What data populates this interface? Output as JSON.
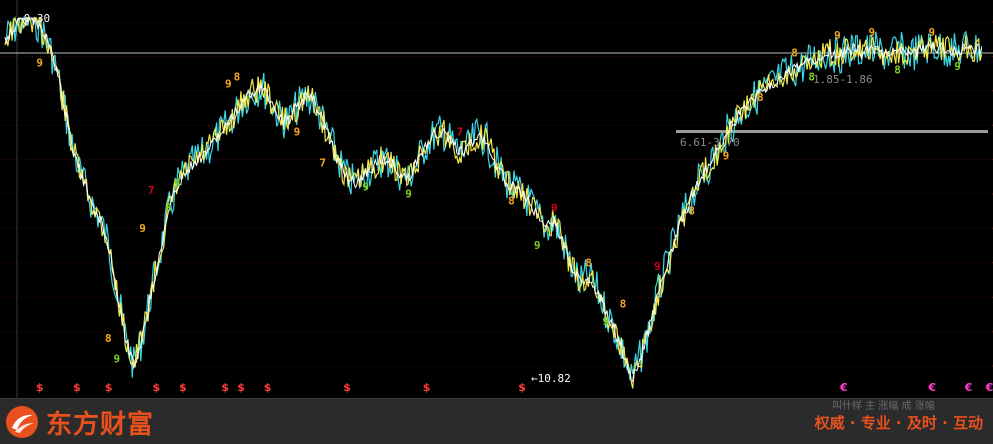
{
  "chart_data": {
    "type": "line",
    "title": "",
    "annotations": {
      "high_marker": "←0.30",
      "low_marker": "←10.82",
      "range_upper": "1.85-1.86",
      "range_lower": "6.61-3.70"
    },
    "series": [
      {
        "values": [
          0.9,
          0.6,
          0.4,
          0.3,
          0.5,
          1.0,
          1.8,
          3.0,
          4.2,
          5.0,
          5.6,
          6.1,
          6.8,
          8.2,
          9.5,
          10.4,
          9.6,
          8.3,
          7.2,
          6.0,
          5.2,
          4.8,
          4.5,
          4.3,
          4.0,
          3.7,
          3.4,
          3.0,
          2.6,
          2.4,
          2.3,
          2.7,
          3.2,
          3.3,
          2.9,
          2.6,
          2.7,
          3.3,
          3.9,
          4.5,
          5.0,
          5.1,
          4.8,
          4.6,
          4.4,
          4.5,
          4.8,
          5.0,
          4.5,
          4.0,
          3.7,
          3.6,
          3.9,
          4.2,
          4.1,
          3.7,
          3.8,
          4.4,
          4.9,
          5.2,
          5.4,
          5.6,
          6.0,
          6.4,
          6.2,
          6.8,
          7.5,
          8.0,
          7.8,
          8.2,
          8.8,
          9.3,
          10.0,
          10.8,
          10.2,
          9.4,
          8.4,
          7.6,
          6.8,
          6.1,
          5.5,
          5.0,
          4.6,
          4.2,
          3.7,
          3.3,
          3.0,
          2.7,
          2.5,
          2.3,
          2.1,
          1.9,
          1.8,
          1.7,
          1.5,
          1.4,
          1.3,
          1.4,
          1.3,
          1.2,
          1.3,
          1.2,
          1.3,
          1.4,
          1.2,
          1.3,
          1.3,
          1.2,
          1.1,
          1.2,
          1.2,
          1.3,
          1.1,
          1.2,
          1.2
        ]
      }
    ],
    "signals": [
      {
        "label": "9",
        "i": 4,
        "v": 1.6,
        "color": "#f5a623"
      },
      {
        "label": "8",
        "i": 12,
        "v": 9.6,
        "color": "#f5a623"
      },
      {
        "label": "9",
        "i": 13,
        "v": 10.2,
        "color": "#7ed321"
      },
      {
        "label": "9",
        "i": 16,
        "v": 6.4,
        "color": "#f5a623"
      },
      {
        "label": "7",
        "i": 17,
        "v": 5.3,
        "color": "#d0021b"
      },
      {
        "label": "8",
        "i": 19,
        "v": 5.8,
        "color": "#7ed321"
      },
      {
        "label": "9",
        "i": 20,
        "v": 5.1,
        "color": "#7ed321"
      },
      {
        "label": "9",
        "i": 26,
        "v": 2.2,
        "color": "#f5a623"
      },
      {
        "label": "8",
        "i": 27,
        "v": 2.0,
        "color": "#f5a623"
      },
      {
        "label": "9",
        "i": 34,
        "v": 3.6,
        "color": "#f5a623"
      },
      {
        "label": "7",
        "i": 37,
        "v": 4.5,
        "color": "#f5a623"
      },
      {
        "label": "9",
        "i": 42,
        "v": 5.2,
        "color": "#7ed321"
      },
      {
        "label": "9",
        "i": 47,
        "v": 5.4,
        "color": "#7ed321"
      },
      {
        "label": "7",
        "i": 53,
        "v": 3.6,
        "color": "#d0021b"
      },
      {
        "label": "8",
        "i": 59,
        "v": 5.6,
        "color": "#f5a623"
      },
      {
        "label": "9",
        "i": 62,
        "v": 6.9,
        "color": "#7ed321"
      },
      {
        "label": "9",
        "i": 64,
        "v": 5.8,
        "color": "#d0021b"
      },
      {
        "label": "8",
        "i": 68,
        "v": 7.4,
        "color": "#f5a623"
      },
      {
        "label": "9",
        "i": 70,
        "v": 9.1,
        "color": "#7ed321"
      },
      {
        "label": "8",
        "i": 72,
        "v": 8.6,
        "color": "#f5a623"
      },
      {
        "label": "9",
        "i": 76,
        "v": 7.5,
        "color": "#d0021b"
      },
      {
        "label": "8",
        "i": 80,
        "v": 5.9,
        "color": "#f5a623"
      },
      {
        "label": "9",
        "i": 84,
        "v": 4.3,
        "color": "#f5a623"
      },
      {
        "label": "8",
        "i": 88,
        "v": 2.6,
        "color": "#f5a623"
      },
      {
        "label": "8",
        "i": 92,
        "v": 1.3,
        "color": "#f5a623"
      },
      {
        "label": "8",
        "i": 94,
        "v": 2.0,
        "color": "#7ed321"
      },
      {
        "label": "9",
        "i": 97,
        "v": 0.8,
        "color": "#f5a623"
      },
      {
        "label": "9",
        "i": 101,
        "v": 0.7,
        "color": "#f5a623"
      },
      {
        "label": "8",
        "i": 104,
        "v": 1.8,
        "color": "#7ed321"
      },
      {
        "label": "9",
        "i": 108,
        "v": 0.7,
        "color": "#f5a623"
      },
      {
        "label": "9",
        "i": 111,
        "v": 1.7,
        "color": "#7ed321"
      }
    ],
    "buy_markers": [
      3,
      10,
      16,
      25,
      30,
      38,
      41,
      46,
      61,
      76,
      94
    ],
    "sell_markers": [
      150,
      167,
      174,
      178
    ]
  },
  "footer": {
    "brand_name": "东方财富",
    "slogan": "权威 · 专业 · 及时 · 互动",
    "hint_text": "叫什样 主 涨幅  成 涨幅"
  },
  "colors": {
    "brand": "#e8501e",
    "line_cyan": "#3ad7e6",
    "line_yellow": "#f1e94b",
    "line_white": "#ffffff",
    "grid": "#5a0f0f",
    "buy_marker": "#ff3b3b",
    "sell_marker": "#ff3bd1"
  },
  "icons": {
    "logo": "dongfang-caifu-logo-icon",
    "buy": "dollar-sign-icon",
    "sell": "euro-sign-icon"
  }
}
